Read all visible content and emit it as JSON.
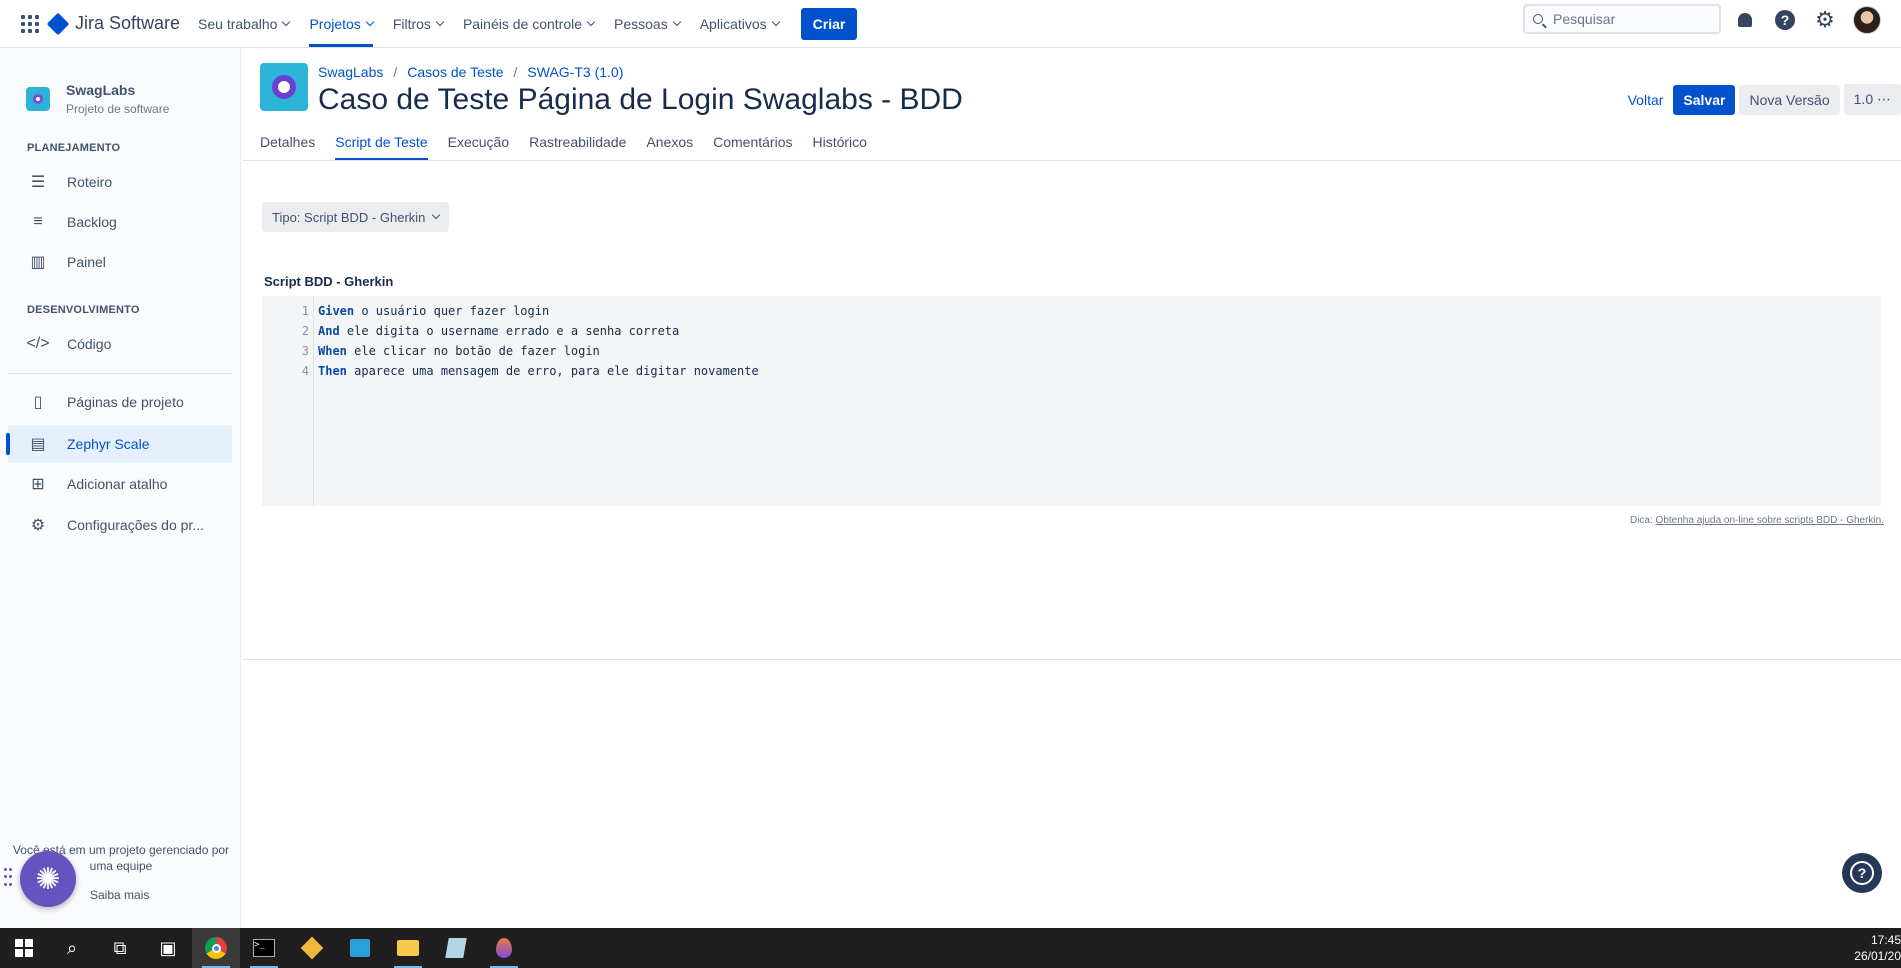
{
  "topnav": {
    "app_name": "Jira Software",
    "items": [
      {
        "label": "Seu trabalho"
      },
      {
        "label": "Projetos"
      },
      {
        "label": "Filtros"
      },
      {
        "label": "Painéis de controle"
      },
      {
        "label": "Pessoas"
      },
      {
        "label": "Aplicativos"
      }
    ],
    "create_label": "Criar",
    "search_placeholder": "Pesquisar"
  },
  "sidebar": {
    "project_name": "SwagLabs",
    "project_type": "Projeto de software",
    "section_planning": "PLANEJAMENTO",
    "section_dev": "DESENVOLVIMENTO",
    "items": [
      {
        "label": "Roteiro",
        "icon": "roadmap-icon"
      },
      {
        "label": "Backlog",
        "icon": "backlog-icon"
      },
      {
        "label": "Painel",
        "icon": "board-icon"
      },
      {
        "label": "Código",
        "icon": "code-icon"
      },
      {
        "label": "Páginas de projeto",
        "icon": "pages-icon"
      },
      {
        "label": "Zephyr Scale",
        "icon": "zephyr-icon"
      },
      {
        "label": "Adicionar atalho",
        "icon": "add-shortcut-icon"
      },
      {
        "label": "Configurações do pr...",
        "icon": "settings-icon"
      }
    ],
    "footer_text": "Você está em um projeto gerenciado por uma equipe",
    "footer_link": "Saiba mais"
  },
  "main": {
    "breadcrumbs": [
      "SwagLabs",
      "Casos de Teste",
      "SWAG-T3 (1.0)"
    ],
    "title": "Caso de Teste Página de Login Swaglabs - BDD",
    "actions": {
      "back": "Voltar",
      "save": "Salvar",
      "new_version": "Nova Versão",
      "version": "1.0"
    },
    "tabs": [
      "Detalhes",
      "Script de Teste",
      "Execução",
      "Rastreabilidade",
      "Anexos",
      "Comentários",
      "Histórico"
    ],
    "active_tab": "Script de Teste",
    "type_select": "Tipo: Script BDD - Gherkin",
    "script_label": "Script BDD - Gherkin",
    "script_lines": [
      {
        "num": "1",
        "keyword": "Given",
        "text": " o usuário quer fazer login"
      },
      {
        "num": "2",
        "keyword": "And",
        "text": " ele digita o username errado e a senha correta"
      },
      {
        "num": "3",
        "keyword": "When",
        "text": " ele clicar no botão de fazer login"
      },
      {
        "num": "4",
        "keyword": "Then",
        "text": " aparece uma mensagem de erro, para ele digitar novamente"
      }
    ],
    "hint_prefix": "Dica:",
    "hint_link": "Obtenha ajuda on-line sobre scripts BDD - Gherkin."
  },
  "taskbar": {
    "time": "17:45",
    "date": "26/01/20"
  },
  "colors": {
    "brand": "#0052cc",
    "sidebar_bg": "#fafbfc",
    "selected_bg": "#e6effc"
  }
}
